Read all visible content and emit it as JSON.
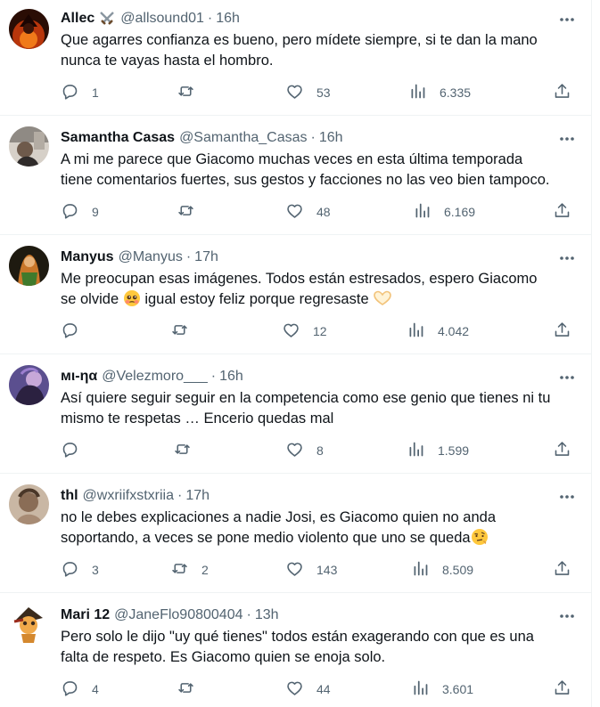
{
  "tweets": [
    {
      "name": "Allec",
      "badge": "crossed-swords-emoji",
      "handle": "@allsound01",
      "time": "16h",
      "text": [
        "Que agarres confianza es bueno, pero mídete siempre, si te dan la mano",
        "nunca te vayas hasta el hombro."
      ],
      "replies": "1",
      "retweets": "",
      "likes": "53",
      "views": "6.335"
    },
    {
      "name": "Samantha Casas",
      "handle": "@Samantha_Casas",
      "time": "16h",
      "text": [
        "A mi me parece que Giacomo muchas veces en esta última temporada",
        "tiene comentarios fuertes, sus gestos y facciones no las veo bien tampoco."
      ],
      "replies": "9",
      "retweets": "",
      "likes": "48",
      "views": "6.169"
    },
    {
      "name": "Manyus",
      "handle": "@Manyus",
      "time": "17h",
      "text_line1": "Me preocupan esas imágenes. Todos están estresados, espero Giacomo",
      "text_line2_a": "se olvide",
      "text_line2_b": "igual estoy feliz porque regresaste",
      "emojis": [
        "pleading-face-emoji",
        "heart-hands-emoji"
      ],
      "replies": "",
      "retweets": "",
      "likes": "12",
      "views": "4.042"
    },
    {
      "name": "мι-ηα",
      "handle": "@Velezmoro___",
      "time": "16h",
      "text": [
        "Así quiere seguir seguir en la competencia como ese genio que tienes ni tu",
        "mismo te respetas … Encerio quedas mal"
      ],
      "replies": "",
      "retweets": "",
      "likes": "8",
      "views": "1.599"
    },
    {
      "name": "thl",
      "handle": "@wxriifxstxriia",
      "time": "17h",
      "text_line1": "no le debes explicaciones a nadie Josi, es Giacomo quien no anda",
      "text_line2_a": "soportando, a veces se pone medio violento que uno se queda",
      "emojis": [
        "face-with-raised-eyebrow-emoji"
      ],
      "replies": "3",
      "retweets": "2",
      "likes": "143",
      "views": "8.509"
    },
    {
      "name": "Mari 12",
      "handle": "@JaneFlo90800404",
      "time": "13h",
      "text": [
        "Pero solo le dijo \"uy qué tienes\" todos están exagerando con que es una",
        "falta de respeto. Es Giacomo quien se enoja solo."
      ],
      "replies": "4",
      "retweets": "",
      "likes": "44",
      "views": "3.601"
    }
  ],
  "separator": "·",
  "icons": [
    "reply-icon",
    "retweet-icon",
    "like-icon",
    "views-icon",
    "share-icon",
    "more-icon"
  ],
  "colors": {
    "text": "#0f1419",
    "secondary": "#536471",
    "border": "#eff3f4"
  }
}
